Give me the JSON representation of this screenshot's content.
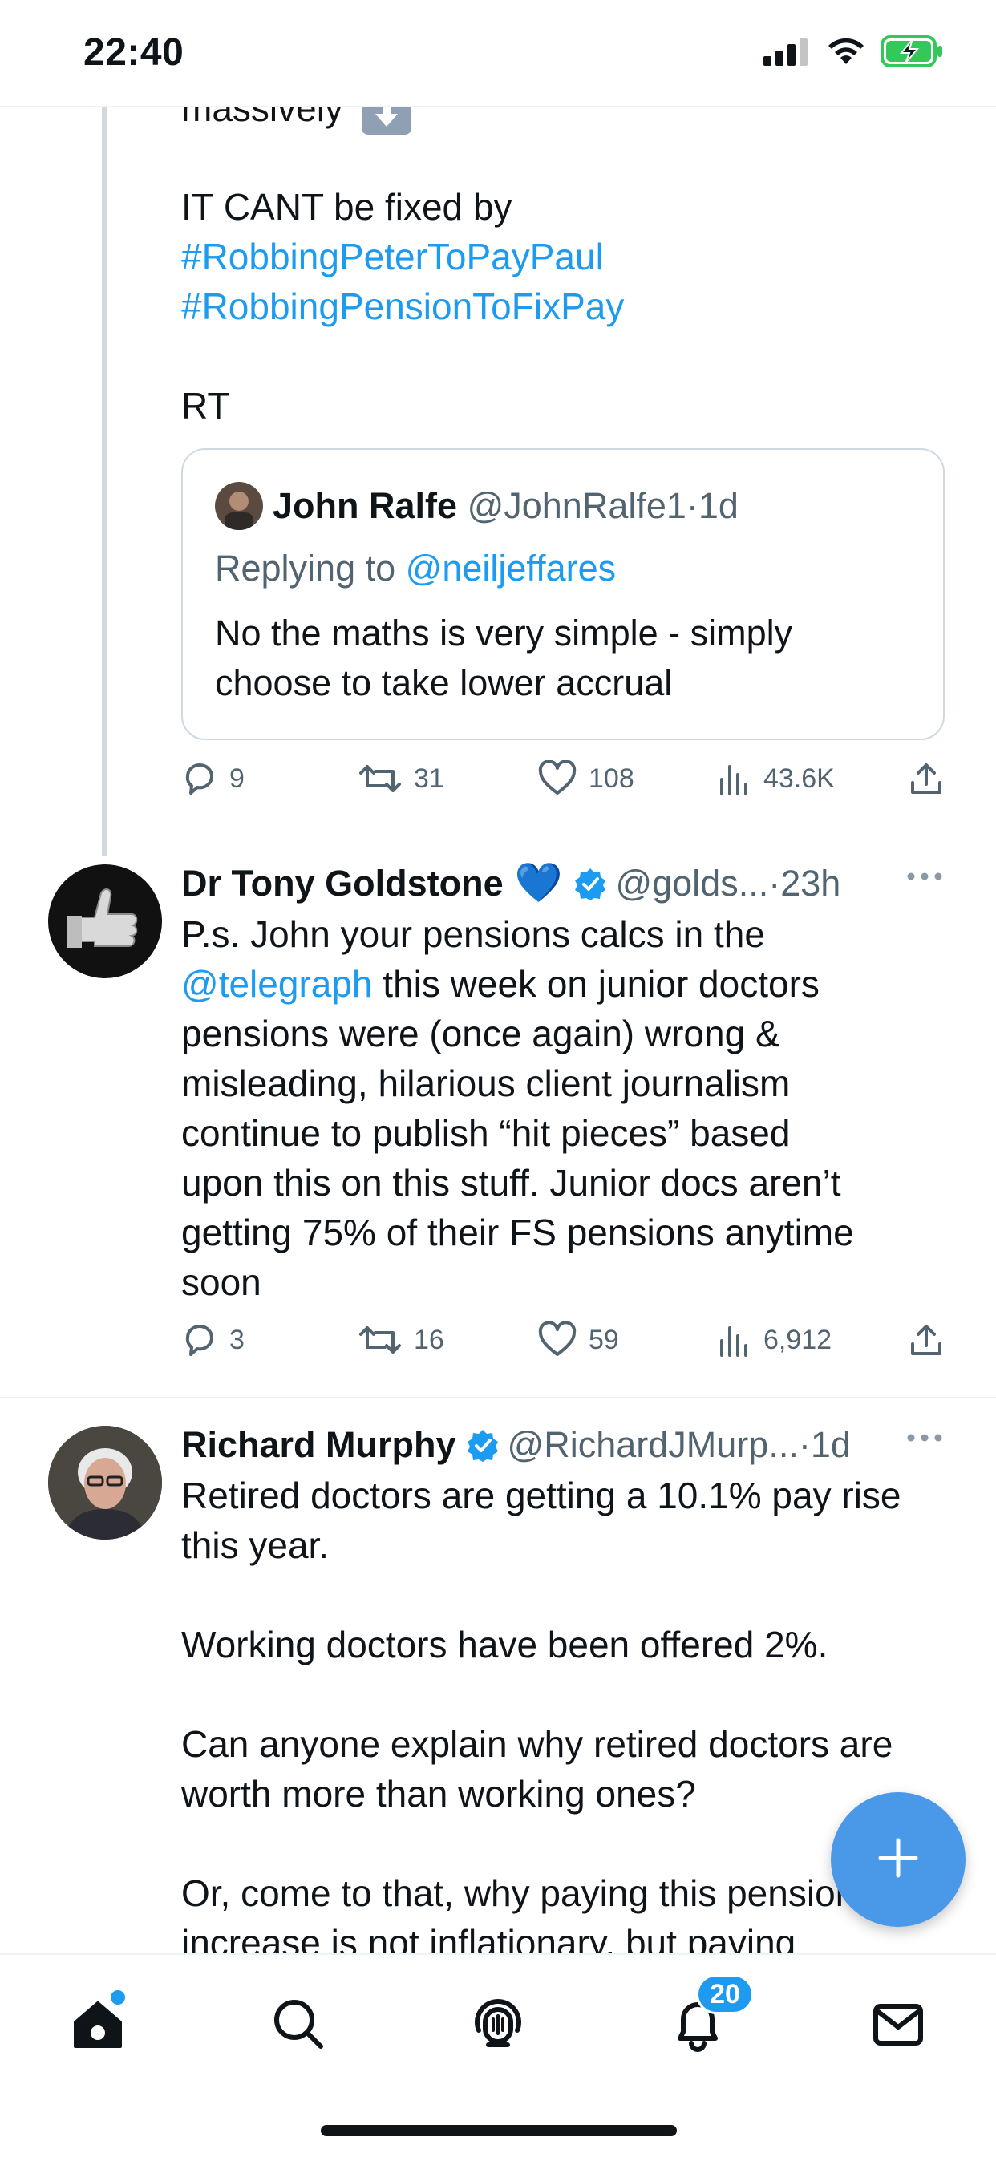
{
  "status_bar": {
    "time": "22:40",
    "battery_color": "#34c759"
  },
  "tweet_top": {
    "partial_line": "massively",
    "emoji_icon": "down-arrow-emoji-icon",
    "line_1": "IT CANT be fixed by",
    "hashtag_1": "#RobbingPeterToPayPaul",
    "hashtag_2": "#RobbingPensionToFixPay",
    "line_rt": "RT",
    "quote": {
      "name": "John Ralfe",
      "handle": "@JohnRalfe1",
      "dot": "·",
      "time": "1d",
      "replying_to_label": "Replying to",
      "replying_to_handle": "@neiljeffares",
      "text_line_1": "No the maths is very simple - simply",
      "text_line_2": "choose to take lower accrual"
    },
    "stats": {
      "replies": "9",
      "retweets": "31",
      "likes": "108",
      "views": "43.6K"
    }
  },
  "tweet_goldstone": {
    "name": "Dr Tony Goldstone",
    "emoji": "💙",
    "handle": "@golds...",
    "dot": "·",
    "time": "23h",
    "line_1": "P.s. John your pensions calcs in the",
    "mention": "@telegraph",
    "line_2_rest": " this week on junior doctors",
    "line_3": "pensions were (once again) wrong &",
    "line_4": "misleading, hilarious client journalism",
    "line_5": "continue to publish “hit pieces” based",
    "line_6": "upon this on this stuff. Junior docs aren’t",
    "line_7": "getting 75% of their FS pensions anytime",
    "line_8": "soon",
    "stats": {
      "replies": "3",
      "retweets": "16",
      "likes": "59",
      "views": "6,912"
    }
  },
  "tweet_murphy": {
    "name": "Richard Murphy",
    "handle": "@RichardJMurp...",
    "dot": "·",
    "time": "1d",
    "line_1": "Retired doctors are getting a 10.1% pay rise",
    "line_2": "this year.",
    "line_3": "Working doctors have been offered 2%.",
    "line_4": "Can anyone explain why retired doctors are",
    "line_5": "worth more than working ones?",
    "line_6": "Or, come to that, why paying this pension",
    "line_7": "increase is not inflationary, but paying"
  },
  "fab": {
    "icon": "plus-icon"
  },
  "bottom_nav": {
    "items": [
      "home-icon",
      "search-icon",
      "spaces-icon",
      "notifications-icon",
      "messages-icon"
    ],
    "notifications_badge": "20"
  },
  "colors": {
    "accent": "#1d9bf0",
    "fab": "#4a99e9",
    "verified": "#1d9bf0",
    "muted_text": "#536471"
  }
}
